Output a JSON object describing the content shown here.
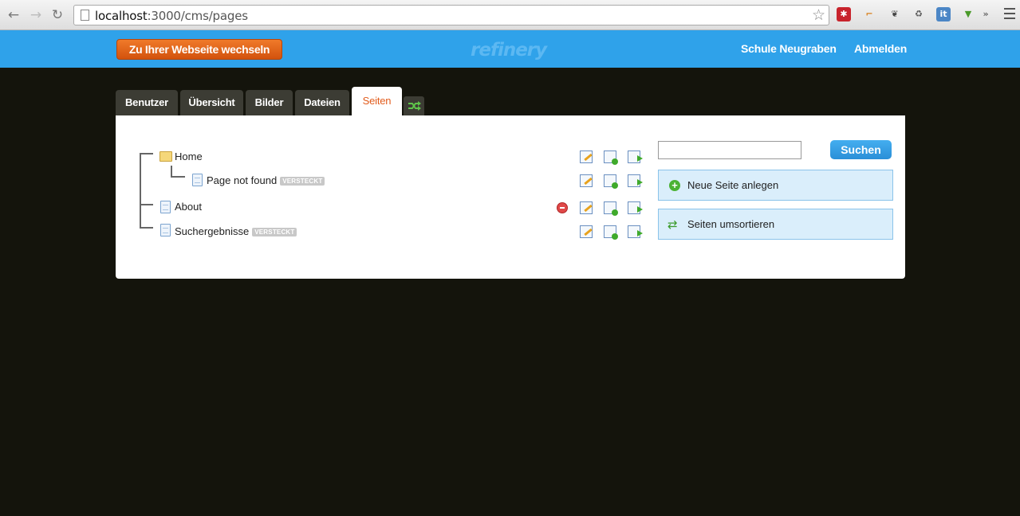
{
  "browser": {
    "url_host": "localhost",
    "url_path": ":3000/cms/pages"
  },
  "header": {
    "site_button": "Zu Ihrer Webseite wechseln",
    "logo": "refinery",
    "site_name": "Schule Neugraben",
    "logout": "Abmelden"
  },
  "tabs": [
    {
      "label": "Benutzer"
    },
    {
      "label": "Übersicht"
    },
    {
      "label": "Bilder"
    },
    {
      "label": "Dateien"
    },
    {
      "label": "Seiten",
      "active": true
    }
  ],
  "pages": [
    {
      "title": "Home",
      "badge": ""
    },
    {
      "title": "Page not found",
      "badge": "VERSTECKT"
    },
    {
      "title": "About",
      "badge": ""
    },
    {
      "title": "Suchergebnisse",
      "badge": "VERSTECKT"
    }
  ],
  "sidebar": {
    "search_value": "",
    "search_button": "Suchen",
    "new_page": "Neue Seite anlegen",
    "reorder": "Seiten umsortieren"
  },
  "colors": {
    "header_blue": "#2fa2ea",
    "accent_orange": "#e25c1c",
    "background": "#14140c"
  }
}
